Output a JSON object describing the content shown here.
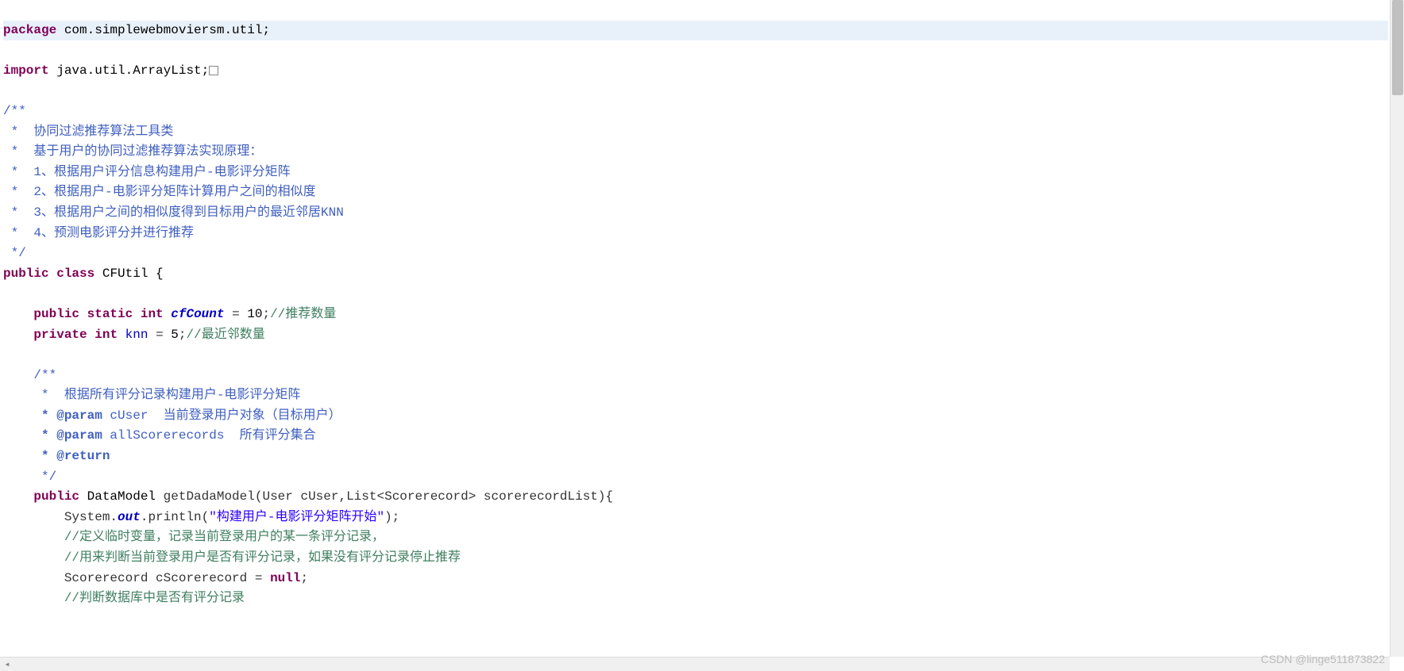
{
  "code": {
    "line1_kw": "package",
    "line1_pkg": " com.simplewebmoviersm.util;",
    "line3_kw": "import",
    "line3_pkg": " java.util.ArrayList;",
    "doc1": "/**",
    "doc2": " *  协同过滤推荐算法工具类",
    "doc3": " *  基于用户的协同过滤推荐算法实现原理：",
    "doc4": " *  1、根据用户评分信息构建用户-电影评分矩阵",
    "doc5": " *  2、根据用户-电影评分矩阵计算用户之间的相似度",
    "doc6": " *  3、根据用户之间的相似度得到目标用户的最近邻居KNN",
    "doc7": " *  4、预测电影评分并进行推荐",
    "doc8": " */",
    "cls_kw1": "public",
    "cls_kw2": "class",
    "cls_name": "CFUtil",
    "cls_brace": " {",
    "f1_kw1": "public",
    "f1_kw2": "static",
    "f1_kw3": "int",
    "f1_name": "cfCount",
    "f1_eq": " = ",
    "f1_val": "10",
    "f1_semi": ";",
    "f1_comment": "//推荐数量",
    "f2_kw1": "private",
    "f2_kw2": "int",
    "f2_name": "knn",
    "f2_eq": " = ",
    "f2_val": "5",
    "f2_semi": ";",
    "f2_comment": "//最近邻数量",
    "mdoc1": "/**",
    "mdoc2": " *  根据所有评分记录构建用户-电影评分矩阵",
    "mdoc3_ann": " * @param",
    "mdoc3_p": " cUser",
    "mdoc3_desc": "  当前登录用户对象（目标用户）",
    "mdoc4_ann": " * @param",
    "mdoc4_p": " allScorerecords",
    "mdoc4_desc": "  所有评分集合",
    "mdoc5_ann": " * @return",
    "mdoc6": " */",
    "m_kw": "public",
    "m_ret": " DataModel ",
    "m_name": "getDadaModel",
    "m_sig": "(User cUser,List<Scorerecord> scorerecordList){",
    "m_l1a": "System.",
    "m_l1b": "out",
    "m_l1c": ".println(",
    "m_l1_str": "\"构建用户-电影评分矩阵开始\"",
    "m_l1d": ");",
    "m_l2": "//定义临时变量，记录当前登录用户的某一条评分记录，",
    "m_l3": "//用来判断当前登录用户是否有评分记录，如果没有评分记录停止推荐",
    "m_l4a": "Scorerecord cScorerecord = ",
    "m_l4_kw": "null",
    "m_l4b": ";",
    "m_l5": "//判断数据库中是否有评分记录"
  },
  "watermark": "CSDN @linge511873822"
}
